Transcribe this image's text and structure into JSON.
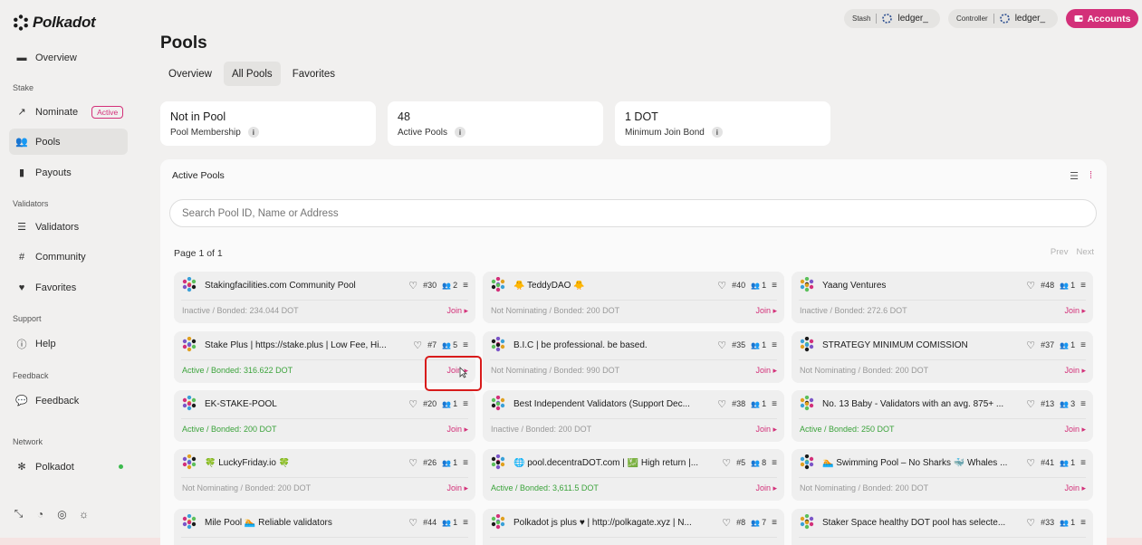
{
  "app": {
    "name": "Polkadot"
  },
  "sidebar": {
    "overview": "Overview",
    "stake_section": "Stake",
    "nominate": "Nominate",
    "nominate_badge": "Active",
    "pools": "Pools",
    "payouts": "Payouts",
    "validators_section": "Validators",
    "validators": "Validators",
    "community": "Community",
    "favorites": "Favorites",
    "support_section": "Support",
    "help": "Help",
    "feedback_section": "Feedback",
    "feedback": "Feedback",
    "network_section": "Network",
    "network": "Polkadot"
  },
  "header": {
    "stash_label": "Stash",
    "stash_account": "ledger_",
    "controller_label": "Controller",
    "controller_account": "ledger_",
    "accounts_button": "Accounts"
  },
  "page": {
    "title": "Pools",
    "tabs": [
      "Overview",
      "All Pools",
      "Favorites"
    ]
  },
  "stats": [
    {
      "value": "Not in Pool",
      "label": "Pool Membership"
    },
    {
      "value": "48",
      "label": "Active Pools"
    },
    {
      "value": "1 DOT",
      "label": "Minimum Join Bond"
    }
  ],
  "pools_panel": {
    "title": "Active Pools",
    "search_placeholder": "Search Pool ID, Name or Address",
    "page_info": "Page 1 of 1",
    "prev": "Prev",
    "next": "Next",
    "join_label": "Join",
    "pools": [
      {
        "name": "Stakingfacilities.com Community Pool",
        "id": "#30",
        "members": "2",
        "status": "Inactive / Bonded: 234.044 DOT",
        "active": false
      },
      {
        "name": "🐥 TeddyDAO 🐥",
        "id": "#40",
        "members": "1",
        "status": "Not Nominating / Bonded: 200 DOT",
        "active": false
      },
      {
        "name": "Yaang Ventures",
        "id": "#48",
        "members": "1",
        "status": "Inactive / Bonded: 272.6 DOT",
        "active": false
      },
      {
        "name": "Stake Plus | https://stake.plus | Low Fee, Hi...",
        "id": "#7",
        "members": "5",
        "status": "Active / Bonded: 316.622 DOT",
        "active": true
      },
      {
        "name": "B.I.C | be professional. be based.",
        "id": "#35",
        "members": "1",
        "status": "Not Nominating / Bonded: 990 DOT",
        "active": false
      },
      {
        "name": "STRATEGY MINIMUM COMISSION",
        "id": "#37",
        "members": "1",
        "status": "Not Nominating / Bonded: 200 DOT",
        "active": false
      },
      {
        "name": "EK-STAKE-POOL",
        "id": "#20",
        "members": "1",
        "status": "Active / Bonded: 200 DOT",
        "active": true
      },
      {
        "name": "Best Independent Validators (Support Dec...",
        "id": "#38",
        "members": "1",
        "status": "Inactive / Bonded: 200 DOT",
        "active": false
      },
      {
        "name": "No. 13 Baby - Validators with an avg. 875+ ...",
        "id": "#13",
        "members": "3",
        "status": "Active / Bonded: 250 DOT",
        "active": true
      },
      {
        "name": "🍀 LuckyFriday.io 🍀",
        "id": "#26",
        "members": "1",
        "status": "Not Nominating / Bonded: 200 DOT",
        "active": false
      },
      {
        "name": "🌐 pool.decentraDOT.com | 💹 High return |...",
        "id": "#5",
        "members": "8",
        "status": "Active / Bonded: 3,611.5 DOT",
        "active": true
      },
      {
        "name": "🏊 Swimming Pool – No Sharks 🐳 Whales ...",
        "id": "#41",
        "members": "1",
        "status": "Not Nominating / Bonded: 200 DOT",
        "active": false
      },
      {
        "name": "Mile Pool 🏊 Reliable validators",
        "id": "#44",
        "members": "1",
        "status": "",
        "active": false
      },
      {
        "name": "Polkadot js plus ♥ | http://polkagate.xyz | N...",
        "id": "#8",
        "members": "7",
        "status": "",
        "active": false
      },
      {
        "name": "Staker Space healthy DOT pool has selecte...",
        "id": "#33",
        "members": "1",
        "status": "",
        "active": false
      }
    ]
  },
  "colors": {
    "accent": "#d33079",
    "active_green": "#3ba33b",
    "highlight": "#d81b1b"
  }
}
